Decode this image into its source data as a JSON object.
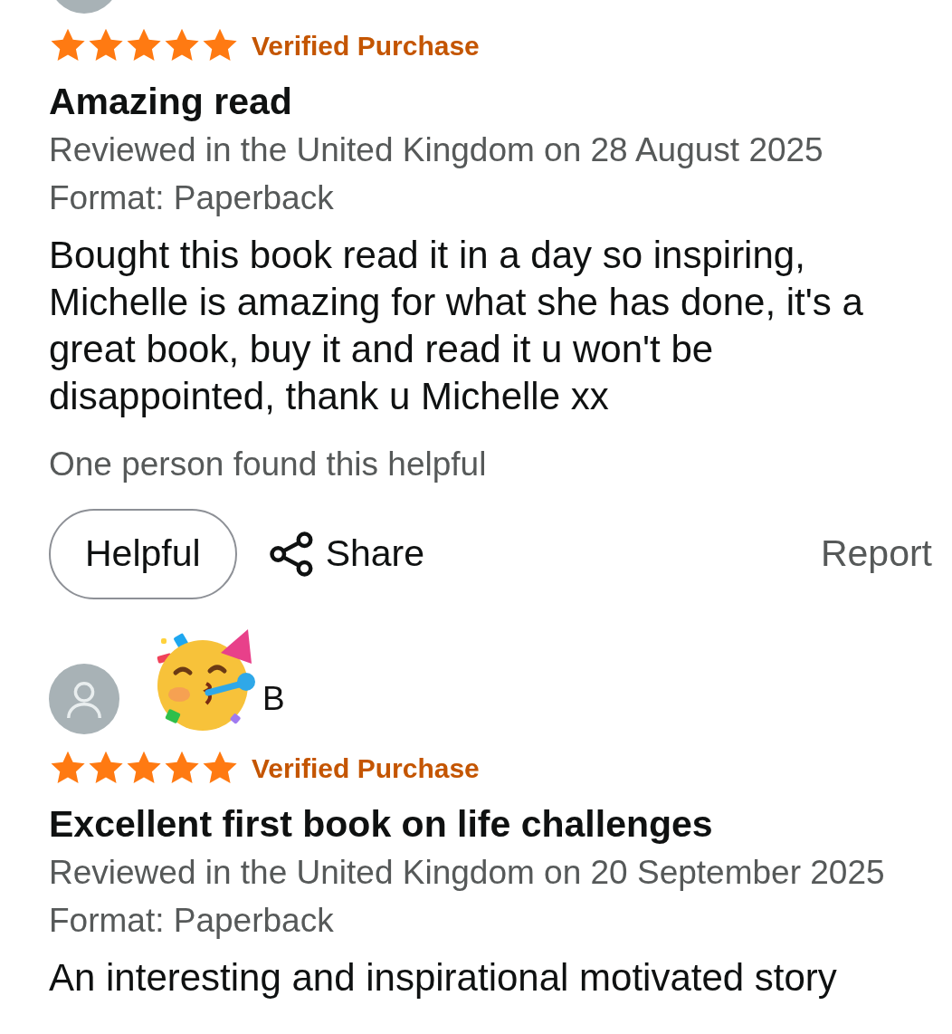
{
  "reviews": [
    {
      "reviewer": {
        "cut_off": true
      },
      "stars": 5,
      "badge": "Verified Purchase",
      "title": "Amazing read",
      "meta": "Reviewed in the United Kingdom on 28 August 2025",
      "format": "Format: Paperback",
      "body": "Bought this book read it in a day so inspiring, Michelle is amazing for what she has done, it's a great book, buy it and read it u won't be disappointed, thank u Michelle xx",
      "helpful_note": "One person found this helpful",
      "actions": {
        "helpful": "Helpful",
        "share": "Share",
        "report": "Report"
      }
    },
    {
      "reviewer": {
        "name": "B",
        "cut_off": false,
        "sticker": true
      },
      "stars": 5,
      "badge": "Verified Purchase",
      "title": "Excellent first book on life challenges",
      "meta": "Reviewed in the United Kingdom on 20 September 2025",
      "format": "Format: Paperback",
      "body": "An interesting and inspirational motivated story"
    }
  ]
}
